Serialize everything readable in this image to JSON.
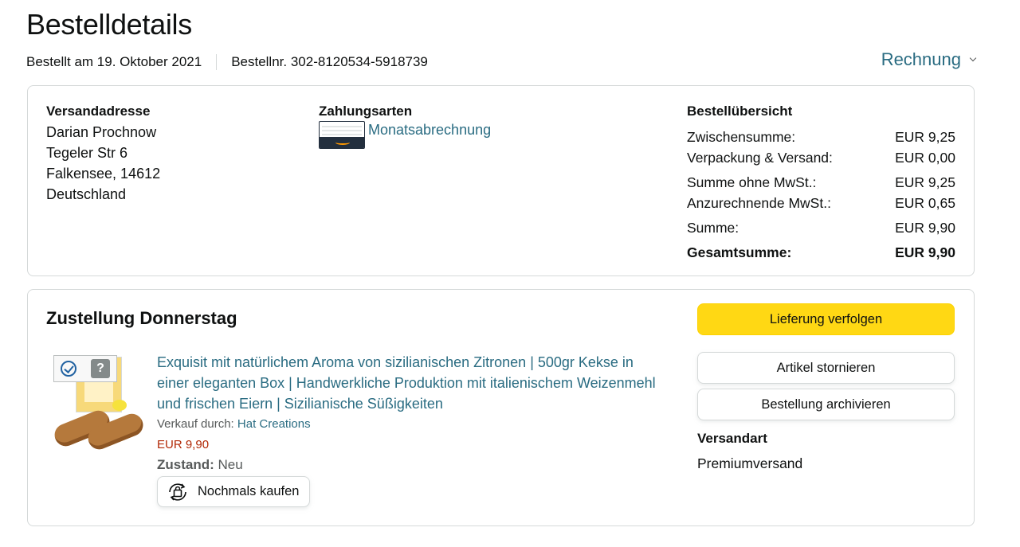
{
  "page": {
    "title": "Bestelldetails",
    "order_date": "Bestellt am 19. Oktober 2021",
    "order_number": "Bestellnr. 302-8120534-5918739",
    "invoice_label": "Rechnung"
  },
  "address": {
    "title": "Versandadresse",
    "lines": [
      "Darian Prochnow",
      "Tegeler Str 6",
      "Falkensee, 14612",
      "Deutschland"
    ]
  },
  "payment": {
    "title": "Zahlungsarten",
    "method": "Monatsabrechnung",
    "icon": "amazon-card-icon"
  },
  "summary": {
    "title": "Bestellübersicht",
    "rows": [
      {
        "label": "Zwischensumme:",
        "value": "EUR 9,25"
      },
      {
        "label": "Verpackung & Versand:",
        "value": "EUR 0,00"
      },
      {
        "label": "Summe ohne MwSt.:",
        "value": "EUR 9,25"
      },
      {
        "label": "Anzurechnende MwSt.:",
        "value": "EUR 0,65"
      },
      {
        "label": "Summe:",
        "value": "EUR 9,90"
      },
      {
        "label": "Gesamtsumme:",
        "value": "EUR 9,90"
      }
    ]
  },
  "delivery": {
    "title": "Zustellung Donnerstag",
    "item": {
      "title": "Exquisit mit natürlichem Aroma von sizilianischen Zitronen | 500gr Kekse in einer eleganten Box | Handwerkliche Produktion mit italienischem Weizenmehl und frischen Eiern | Sizilianische Süßigkeiten",
      "seller_prefix": "Verkauf durch:",
      "seller": "Hat Creations",
      "price": "EUR 9,90",
      "condition_label": "Zustand:",
      "condition_value": "Neu",
      "rebuy_label": "Nochmals kaufen"
    },
    "actions": {
      "track": "Lieferung verfolgen",
      "cancel": "Artikel stornieren",
      "archive": "Bestellung archivieren"
    },
    "shipping_title": "Versandart",
    "shipping_value": "Premiumversand"
  },
  "colors": {
    "link": "#2a6c82",
    "price": "#b12704",
    "button_yellow": "#ffd814",
    "border": "#d5d9d9"
  }
}
